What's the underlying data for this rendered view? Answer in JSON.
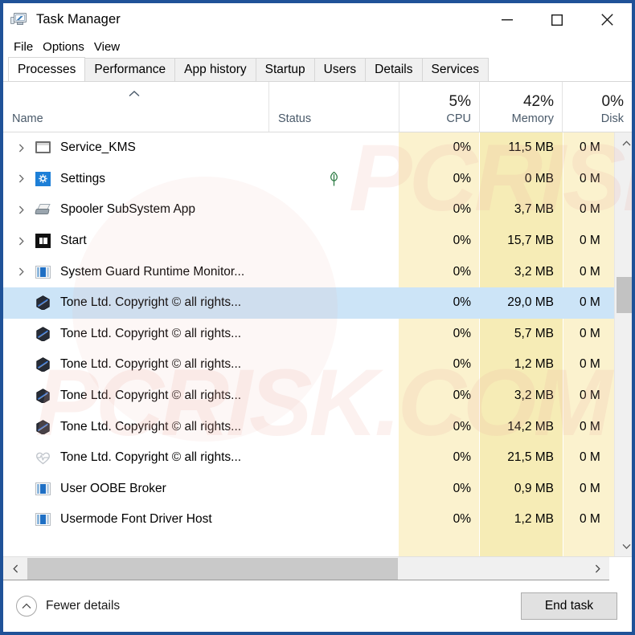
{
  "window": {
    "title": "Task Manager",
    "icon": "task-manager-icon",
    "controls": {
      "minimize": "minimize",
      "maximize": "maximize",
      "close": "close"
    }
  },
  "menu": {
    "items": [
      "File",
      "Options",
      "View"
    ]
  },
  "tabs": {
    "active": "Processes",
    "items": [
      "Processes",
      "Performance",
      "App history",
      "Startup",
      "Users",
      "Details",
      "Services"
    ]
  },
  "columns": [
    {
      "key": "name",
      "label": "Name",
      "pct": "",
      "sort": "asc"
    },
    {
      "key": "status",
      "label": "Status",
      "pct": ""
    },
    {
      "key": "cpu",
      "label": "CPU",
      "pct": "5%"
    },
    {
      "key": "memory",
      "label": "Memory",
      "pct": "42%"
    },
    {
      "key": "disk",
      "label": "Disk",
      "pct": "0%"
    }
  ],
  "processes": [
    {
      "name": "Service_KMS",
      "icon": "window-icon",
      "expandable": true,
      "status": "",
      "cpu": "0%",
      "memory": "11,5 MB",
      "disk": "0 M",
      "selected": false
    },
    {
      "name": "Settings",
      "icon": "gear-icon",
      "expandable": true,
      "status": "leaf-icon",
      "cpu": "0%",
      "memory": "0 MB",
      "disk": "0 M",
      "selected": false
    },
    {
      "name": "Spooler SubSystem App",
      "icon": "printer-icon",
      "expandable": true,
      "status": "",
      "cpu": "0%",
      "memory": "3,7 MB",
      "disk": "0 M",
      "selected": false
    },
    {
      "name": "Start",
      "icon": "start-icon",
      "expandable": true,
      "status": "",
      "cpu": "0%",
      "memory": "15,7 MB",
      "disk": "0 M",
      "selected": false
    },
    {
      "name": "System Guard Runtime Monitor...",
      "icon": "bluewin-icon",
      "expandable": true,
      "status": "",
      "cpu": "0%",
      "memory": "3,2 MB",
      "disk": "0 M",
      "selected": false
    },
    {
      "name": "Tone Ltd. Copyright © all rights...",
      "icon": "hexagon-icon",
      "expandable": false,
      "status": "",
      "cpu": "0%",
      "memory": "29,0 MB",
      "disk": "0 M",
      "selected": true
    },
    {
      "name": "Tone Ltd. Copyright © all rights...",
      "icon": "hexagon-icon",
      "expandable": false,
      "status": "",
      "cpu": "0%",
      "memory": "5,7 MB",
      "disk": "0 M",
      "selected": false
    },
    {
      "name": "Tone Ltd. Copyright © all rights...",
      "icon": "hexagon-icon",
      "expandable": false,
      "status": "",
      "cpu": "0%",
      "memory": "1,2 MB",
      "disk": "0 M",
      "selected": false
    },
    {
      "name": "Tone Ltd. Copyright © all rights...",
      "icon": "hexagon-icon",
      "expandable": false,
      "status": "",
      "cpu": "0%",
      "memory": "3,2 MB",
      "disk": "0 M",
      "selected": false
    },
    {
      "name": "Tone Ltd. Copyright © all rights...",
      "icon": "hexagon-icon",
      "expandable": false,
      "status": "",
      "cpu": "0%",
      "memory": "14,2 MB",
      "disk": "0 M",
      "selected": false
    },
    {
      "name": "Tone Ltd. Copyright © all rights...",
      "icon": "heart-pulse-icon",
      "expandable": false,
      "status": "",
      "cpu": "0%",
      "memory": "21,5 MB",
      "disk": "0 M",
      "selected": false
    },
    {
      "name": "User OOBE Broker",
      "icon": "bluewin-icon",
      "expandable": false,
      "status": "",
      "cpu": "0%",
      "memory": "0,9 MB",
      "disk": "0 M",
      "selected": false
    },
    {
      "name": "Usermode Font Driver Host",
      "icon": "bluewin-icon",
      "expandable": false,
      "status": "",
      "cpu": "0%",
      "memory": "1,2 MB",
      "disk": "0 M",
      "selected": false
    }
  ],
  "footer": {
    "fewer_details": "Fewer details",
    "end_task": "End task"
  },
  "colors": {
    "window_border": "#1f5298",
    "selection": "#cce4f7",
    "cpu_tint": "#fbf2ce",
    "memory_tint": "#f6ecb6",
    "accent_blue": "#1d7fd7"
  },
  "watermark": {
    "line1": "PCRISK",
    "line2": "PCRISK.COM"
  }
}
